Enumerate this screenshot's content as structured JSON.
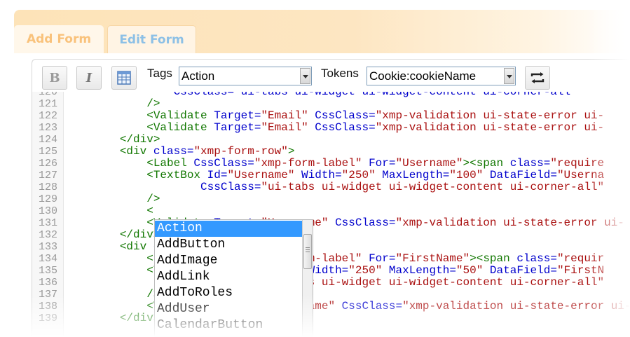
{
  "tabs": [
    {
      "label": "Add Form",
      "active": false
    },
    {
      "label": "Edit Form",
      "active": true
    }
  ],
  "toolbar": {
    "bold_label": "B",
    "italic_label": "I",
    "table_icon": "table-icon",
    "swap_icon": "swap-arrows-icon",
    "tags_label": "Tags",
    "tags_selected": "Action",
    "tokens_label": "Tokens",
    "tokens_selected": "Cookie:cookieName"
  },
  "editor": {
    "lines": [
      {
        "n": "120",
        "indent": "                ",
        "segs": [
          {
            "t": "CssClass=\"ui-tabs ui-widget ui-widget-content ui-corner-all\"",
            "c": "attr"
          }
        ]
      },
      {
        "n": "121",
        "indent": "            ",
        "segs": [
          {
            "t": "/>",
            "c": "tagc"
          }
        ]
      },
      {
        "n": "122",
        "indent": "            ",
        "segs": [
          {
            "t": "<Validate",
            "c": "tagc"
          },
          {
            "t": " Target=",
            "c": "attr"
          },
          {
            "t": "\"Email\"",
            "c": "str"
          },
          {
            "t": " CssClass=",
            "c": "attr"
          },
          {
            "t": "\"xmp-validation ui-state-error ui-",
            "c": "str"
          }
        ]
      },
      {
        "n": "123",
        "indent": "            ",
        "segs": [
          {
            "t": "<Validate",
            "c": "tagc"
          },
          {
            "t": " Target=",
            "c": "attr"
          },
          {
            "t": "\"Email\"",
            "c": "str"
          },
          {
            "t": " CssClass=",
            "c": "attr"
          },
          {
            "t": "\"xmp-validation ui-state-error ui-",
            "c": "str"
          }
        ]
      },
      {
        "n": "124",
        "indent": "        ",
        "segs": [
          {
            "t": "</div>",
            "c": "tagc"
          }
        ]
      },
      {
        "n": "125",
        "indent": "        ",
        "segs": [
          {
            "t": "<div",
            "c": "tagc"
          },
          {
            "t": " class=",
            "c": "attr"
          },
          {
            "t": "\"xmp-form-row\"",
            "c": "str"
          },
          {
            "t": ">",
            "c": "tagc"
          }
        ]
      },
      {
        "n": "126",
        "indent": "            ",
        "segs": [
          {
            "t": "<Label",
            "c": "tagc"
          },
          {
            "t": " CssClass=",
            "c": "attr"
          },
          {
            "t": "\"xmp-form-label\"",
            "c": "str"
          },
          {
            "t": " For=",
            "c": "attr"
          },
          {
            "t": "\"Username\"",
            "c": "str"
          },
          {
            "t": "><span",
            "c": "tagc"
          },
          {
            "t": " class=",
            "c": "attr"
          },
          {
            "t": "\"require",
            "c": "str"
          }
        ]
      },
      {
        "n": "127",
        "indent": "            ",
        "segs": [
          {
            "t": "<TextBox",
            "c": "tagc"
          },
          {
            "t": " Id=",
            "c": "attr"
          },
          {
            "t": "\"Username\"",
            "c": "str"
          },
          {
            "t": " Width=",
            "c": "attr"
          },
          {
            "t": "\"250\"",
            "c": "str"
          },
          {
            "t": " MaxLength=",
            "c": "attr"
          },
          {
            "t": "\"100\"",
            "c": "str"
          },
          {
            "t": " DataField=",
            "c": "attr"
          },
          {
            "t": "\"Userna",
            "c": "str"
          }
        ]
      },
      {
        "n": "128",
        "indent": "                    ",
        "segs": [
          {
            "t": "CssClass=",
            "c": "attr"
          },
          {
            "t": "\"ui-tabs ui-widget ui-widget-content ui-corner-all\"",
            "c": "str"
          }
        ]
      },
      {
        "n": "129",
        "indent": "            ",
        "segs": [
          {
            "t": "/>",
            "c": "tagc"
          }
        ]
      },
      {
        "n": "130",
        "indent": "            ",
        "segs": [
          {
            "t": "<",
            "c": "tagc"
          }
        ]
      },
      {
        "n": "131",
        "indent": "            ",
        "segs": [
          {
            "t": "<Validate",
            "c": "tagc"
          },
          {
            "t": " Target=",
            "c": "attr"
          },
          {
            "t": "\"Username\"",
            "c": "str"
          },
          {
            "t": " CssClass=",
            "c": "attr"
          },
          {
            "t": "\"xmp-validation ui-state-error ui-",
            "c": "str"
          }
        ]
      },
      {
        "n": "132",
        "indent": "        ",
        "segs": [
          {
            "t": "</div>",
            "c": "tagc"
          }
        ]
      },
      {
        "n": "133",
        "indent": "        ",
        "segs": [
          {
            "t": "<div",
            "c": "tagc"
          },
          {
            "t": " class=",
            "c": "attr"
          },
          {
            "t": "\"xmp-form-row\"",
            "c": "str"
          },
          {
            "t": ">",
            "c": "tagc"
          }
        ]
      },
      {
        "n": "134",
        "indent": "            ",
        "segs": [
          {
            "t": "<Label",
            "c": "tagc"
          },
          {
            "t": " CssClass=",
            "c": "attr"
          },
          {
            "t": "\"xmp-form-label\"",
            "c": "str"
          },
          {
            "t": " For=",
            "c": "attr"
          },
          {
            "t": "\"FirstName\"",
            "c": "str"
          },
          {
            "t": "><span",
            "c": "tagc"
          },
          {
            "t": " class=",
            "c": "attr"
          },
          {
            "t": "\"requir",
            "c": "str"
          }
        ]
      },
      {
        "n": "135",
        "indent": "            ",
        "segs": [
          {
            "t": "<TextBox",
            "c": "tagc"
          },
          {
            "t": " Id=",
            "c": "attr"
          },
          {
            "t": "\"FirstName\"",
            "c": "str"
          },
          {
            "t": " Width=",
            "c": "attr"
          },
          {
            "t": "\"250\"",
            "c": "str"
          },
          {
            "t": " MaxLength=",
            "c": "attr"
          },
          {
            "t": "\"50\"",
            "c": "str"
          },
          {
            "t": " DataField=",
            "c": "attr"
          },
          {
            "t": "\"FirstN",
            "c": "str"
          }
        ]
      },
      {
        "n": "136",
        "indent": "                    ",
        "segs": [
          {
            "t": "CssClass=",
            "c": "attr"
          },
          {
            "t": "\"ui-tabs ui-widget ui-widget-content ui-corner-all\"",
            "c": "str"
          }
        ]
      },
      {
        "n": "137",
        "indent": "            ",
        "segs": [
          {
            "t": "/>",
            "c": "tagc"
          }
        ]
      },
      {
        "n": "138",
        "indent": "            ",
        "segs": [
          {
            "t": "<Validate",
            "c": "tagc"
          },
          {
            "t": " Target=",
            "c": "attr"
          },
          {
            "t": "\"FirstName\"",
            "c": "str"
          },
          {
            "t": " CssClass=",
            "c": "attr"
          },
          {
            "t": "\"xmp-validation ui-state-error ui-",
            "c": "str"
          }
        ]
      },
      {
        "n": "139",
        "indent": "        ",
        "segs": [
          {
            "t": "</div>",
            "c": "tagc"
          }
        ]
      }
    ]
  },
  "autocomplete": {
    "options": [
      "Action",
      "AddButton",
      "AddImage",
      "AddLink",
      "AddToRoles",
      "AddUser",
      "CalendarButton"
    ],
    "selected_index": 0
  }
}
